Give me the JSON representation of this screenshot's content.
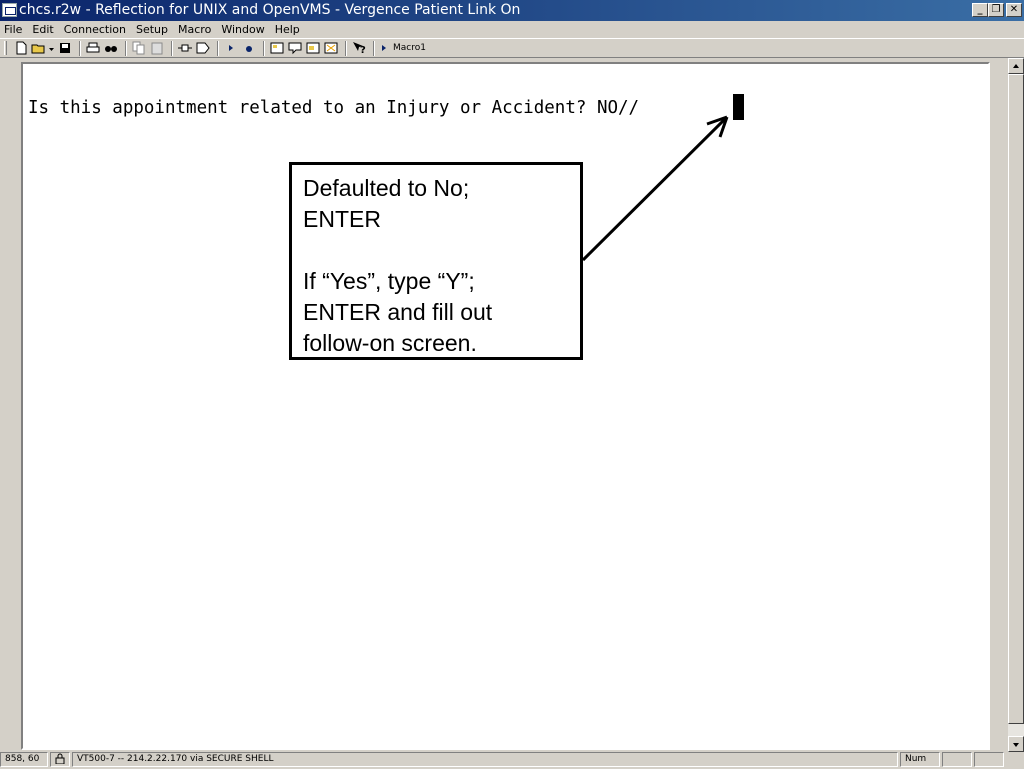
{
  "window": {
    "title": "chcs.r2w - Reflection for UNIX and OpenVMS - Vergence Patient Link On",
    "buttons": {
      "minimize": "_",
      "restore": "❐",
      "close": "✕"
    }
  },
  "menu": [
    {
      "label": "File"
    },
    {
      "label": "Edit"
    },
    {
      "label": "Connection"
    },
    {
      "label": "Setup"
    },
    {
      "label": "Macro"
    },
    {
      "label": "Window"
    },
    {
      "label": "Help"
    }
  ],
  "toolbar": {
    "icons": [
      "new-document-icon",
      "open-folder-icon",
      "save-icon",
      "print-icon",
      "find-icon",
      "copy-icon",
      "paste-icon",
      "connect-icon",
      "disconnect-icon",
      "play-macro-icon",
      "record-macro-icon",
      "settings-icon",
      "keyboard-icon",
      "display-icon",
      "options-icon",
      "help-icon",
      "run-macro-icon"
    ],
    "macro_label": "Macro1"
  },
  "terminal": {
    "prompt_line": "Is this appointment related to an Injury or Accident? NO//"
  },
  "callout": {
    "line1": "Defaulted to No;",
    "line2": "ENTER",
    "line3": "If “Yes”, type “Y”;",
    "line4": "ENTER and fill out",
    "line5": "follow-on screen."
  },
  "statusbar": {
    "position": "858, 60",
    "connection": "VT500-7 -- 214.2.22.170 via SECURE SHELL",
    "num": "Num"
  },
  "colors": {
    "titlebar_start": "#0a246a",
    "titlebar_end": "#3a6ea5",
    "chrome": "#d4d0c8",
    "terminal_bg": "#ffffff",
    "terminal_text": "#000000"
  }
}
